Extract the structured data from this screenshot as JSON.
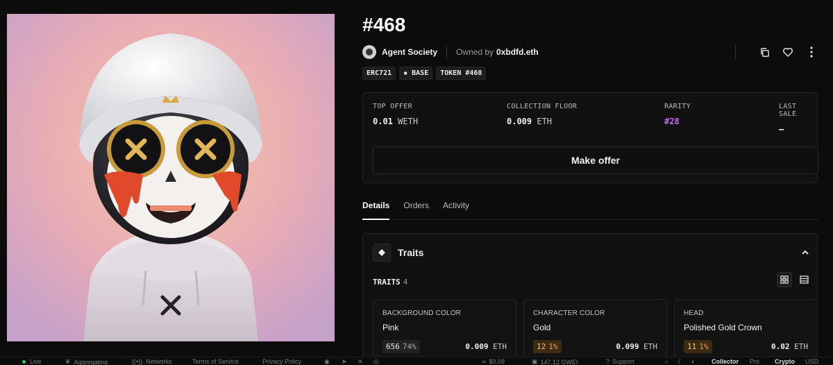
{
  "token": {
    "title": "#468"
  },
  "collection": {
    "name": "Agent Society"
  },
  "owner": {
    "prefix": "Owned by",
    "name": "0xbdfd.eth"
  },
  "tags": [
    "ERC721",
    "▪ BASE",
    "TOKEN #468"
  ],
  "stats": {
    "top_offer": {
      "label": "TOP OFFER",
      "value": "0.01",
      "unit": "WETH"
    },
    "collection_floor": {
      "label": "COLLECTION FLOOR",
      "value": "0.009",
      "unit": "ETH"
    },
    "rarity": {
      "label": "RARITY",
      "value": "#28",
      "color": "#c26cf5"
    },
    "last_sale": {
      "label": "LAST SALE",
      "value": "–"
    }
  },
  "make_offer_label": "Make offer",
  "tabs": [
    "Details",
    "Orders",
    "Activity"
  ],
  "traits": {
    "section_title": "Traits",
    "count_label": "TRAITS",
    "count": "4",
    "items": [
      {
        "type": "BACKGROUND COLOR",
        "value": "Pink",
        "count": "656",
        "pct": "74%",
        "price": "0.009",
        "unit": "ETH",
        "badge": "gray"
      },
      {
        "type": "CHARACTER COLOR",
        "value": "Gold",
        "count": "12",
        "pct": "1%",
        "price": "0.099",
        "unit": "ETH",
        "badge": "orange"
      },
      {
        "type": "HEAD",
        "value": "Polished Gold Crown",
        "count": "11",
        "pct": "1%",
        "price": "0.02",
        "unit": "ETH",
        "badge": "orange"
      }
    ]
  },
  "footer": {
    "live": "Live",
    "aggregating": "Aggregating",
    "networks": "Networks",
    "terms": "Terms of Service",
    "privacy": "Privacy Policy",
    "price": "$0.09",
    "gas": "147.12 GWEI",
    "support": "Support",
    "collector": "Collector",
    "pro": "Pro",
    "crypto": "Crypto",
    "usd": "USD"
  },
  "colors": {
    "accent_purple": "#c26cf5",
    "rarity_orange": "#f0a646",
    "live_green": "#2ecc71"
  }
}
